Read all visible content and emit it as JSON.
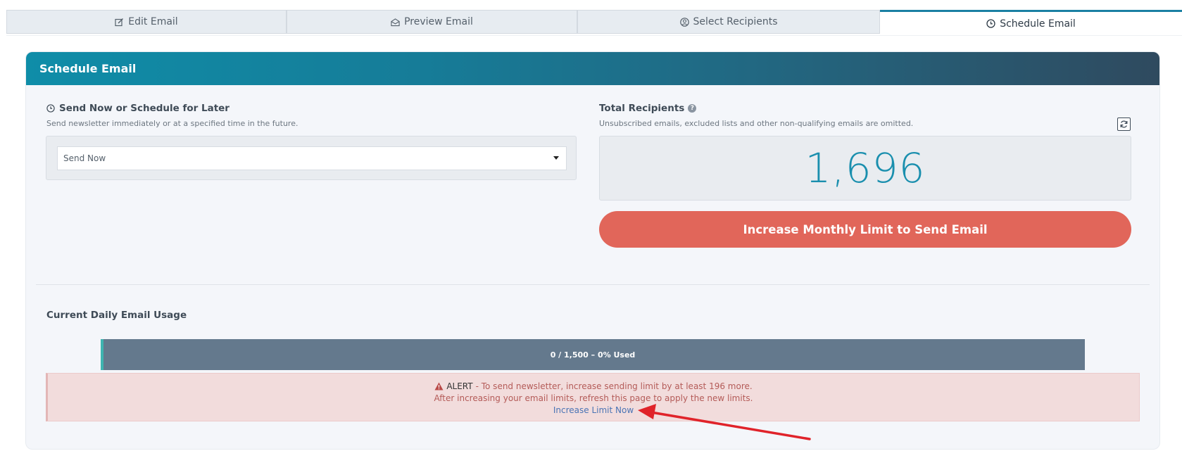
{
  "tabs": [
    {
      "label": "Edit Email",
      "icon": "edit-icon"
    },
    {
      "label": "Preview Email",
      "icon": "envelope-open-icon"
    },
    {
      "label": "Select Recipients",
      "icon": "user-circle-icon"
    },
    {
      "label": "Schedule Email",
      "icon": "clock-icon",
      "active": true
    }
  ],
  "card": {
    "title": "Schedule Email"
  },
  "send_section": {
    "title": "Send Now or Schedule for Later",
    "subtitle": "Send newsletter immediately or at a specified time in the future.",
    "select_value": "Send Now"
  },
  "recipients_section": {
    "title": "Total Recipients",
    "subtitle": "Unsubscribed emails, excluded lists and other non-qualifying emails are omitted.",
    "count": "1,696",
    "button_label": "Increase Monthly Limit to Send Email"
  },
  "usage_section": {
    "title": "Current Daily Email Usage",
    "progress_label": "0 / 1,500 – 0% Used",
    "progress_fraction": 0
  },
  "alert": {
    "label": "ALERT",
    "line1": "- To send newsletter, increase sending limit by at least 196 more.",
    "line2": "After increasing your email limits, refresh this page to apply the new limits.",
    "link": "Increase Limit Now"
  },
  "colors": {
    "accent": "#1a8fae",
    "button": "#e1665a",
    "progress": "#64798d",
    "alert_bg": "#f2dcdc",
    "annotation_arrow": "#e0232a"
  }
}
